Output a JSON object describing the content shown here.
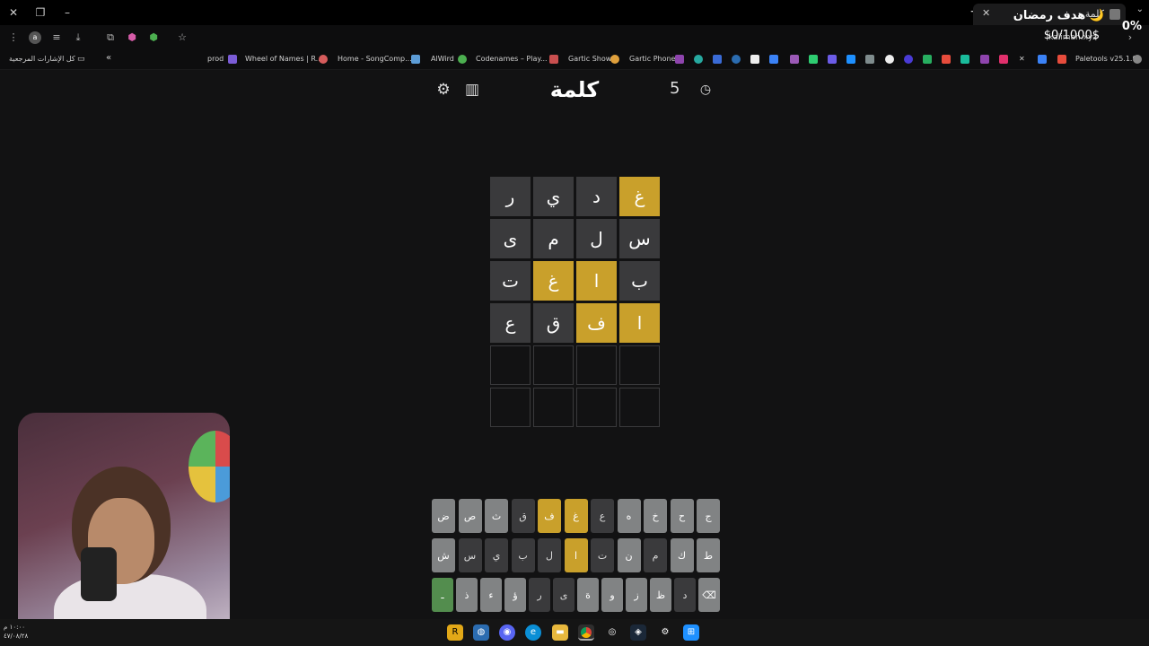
{
  "browser": {
    "tab_title": "كلمة",
    "url": "kalimah.xyz",
    "bookmarks": [
      {
        "label": "كل الإشارات المرجعية",
        "color": ""
      },
      {
        "label": "prod",
        "color": "#7b5cd6"
      },
      {
        "label": "Wheel of Names | R...",
        "color": "#d65c5c"
      },
      {
        "label": "Home - SongComp...",
        "color": "#5c9cd6"
      },
      {
        "label": "AlWird",
        "color": "#4caf50"
      },
      {
        "label": "Codenames – Play...",
        "color": "#c94f4f"
      },
      {
        "label": "Gartic Show",
        "color": "#e0a03c"
      },
      {
        "label": "Gartic Phone",
        "color": "#8e44ad"
      },
      {
        "label": "Paletools v25.1.9",
        "color": "#d64545"
      }
    ]
  },
  "overlay": {
    "goal_label": "هدف رمضان 🌙",
    "goal_percent": "0%",
    "goal_amount": "$0/1000$"
  },
  "game": {
    "title": "كلمة",
    "streak_count": "5",
    "grid": [
      [
        {
          "l": "غ",
          "s": "present"
        },
        {
          "l": "د",
          "s": "absent"
        },
        {
          "l": "ي",
          "s": "absent"
        },
        {
          "l": "ر",
          "s": "absent"
        }
      ],
      [
        {
          "l": "س",
          "s": "absent"
        },
        {
          "l": "ل",
          "s": "absent"
        },
        {
          "l": "م",
          "s": "absent"
        },
        {
          "l": "ى",
          "s": "absent"
        }
      ],
      [
        {
          "l": "ب",
          "s": "absent"
        },
        {
          "l": "ا",
          "s": "present"
        },
        {
          "l": "غ",
          "s": "present"
        },
        {
          "l": "ت",
          "s": "absent"
        }
      ],
      [
        {
          "l": "ا",
          "s": "present"
        },
        {
          "l": "ف",
          "s": "present"
        },
        {
          "l": "ق",
          "s": "absent"
        },
        {
          "l": "ع",
          "s": "absent"
        }
      ],
      [
        {
          "l": "",
          "s": "empty"
        },
        {
          "l": "",
          "s": "empty"
        },
        {
          "l": "",
          "s": "empty"
        },
        {
          "l": "",
          "s": "empty"
        }
      ],
      [
        {
          "l": "",
          "s": "empty"
        },
        {
          "l": "",
          "s": "empty"
        },
        {
          "l": "",
          "s": "empty"
        },
        {
          "l": "",
          "s": "empty"
        }
      ]
    ],
    "keyboard": [
      [
        {
          "k": "ج",
          "s": "unused"
        },
        {
          "k": "ح",
          "s": "unused"
        },
        {
          "k": "خ",
          "s": "unused"
        },
        {
          "k": "ه",
          "s": "unused"
        },
        {
          "k": "ع",
          "s": "absent"
        },
        {
          "k": "غ",
          "s": "present"
        },
        {
          "k": "ف",
          "s": "present"
        },
        {
          "k": "ق",
          "s": "absent"
        },
        {
          "k": "ث",
          "s": "unused"
        },
        {
          "k": "ص",
          "s": "unused"
        },
        {
          "k": "ض",
          "s": "unused"
        }
      ],
      [
        {
          "k": "ط",
          "s": "unused"
        },
        {
          "k": "ك",
          "s": "unused"
        },
        {
          "k": "م",
          "s": "absent"
        },
        {
          "k": "ن",
          "s": "unused"
        },
        {
          "k": "ت",
          "s": "absent"
        },
        {
          "k": "ا",
          "s": "present"
        },
        {
          "k": "ل",
          "s": "absent"
        },
        {
          "k": "ب",
          "s": "absent"
        },
        {
          "k": "ي",
          "s": "absent"
        },
        {
          "k": "س",
          "s": "absent"
        },
        {
          "k": "ش",
          "s": "unused"
        }
      ],
      [
        {
          "k": "⌫",
          "s": "unused"
        },
        {
          "k": "د",
          "s": "absent"
        },
        {
          "k": "ظ",
          "s": "unused"
        },
        {
          "k": "ز",
          "s": "unused"
        },
        {
          "k": "و",
          "s": "unused"
        },
        {
          "k": "ة",
          "s": "unused"
        },
        {
          "k": "ى",
          "s": "absent"
        },
        {
          "k": "ر",
          "s": "absent"
        },
        {
          "k": "ؤ",
          "s": "unused"
        },
        {
          "k": "ء",
          "s": "unused"
        },
        {
          "k": "ذ",
          "s": "unused"
        },
        {
          "k": "ـ",
          "s": "enter"
        }
      ]
    ]
  },
  "taskbar": {
    "clock_time": "١٠:٠٠ م",
    "clock_date": "٤٧/٠٨/٢٨"
  }
}
